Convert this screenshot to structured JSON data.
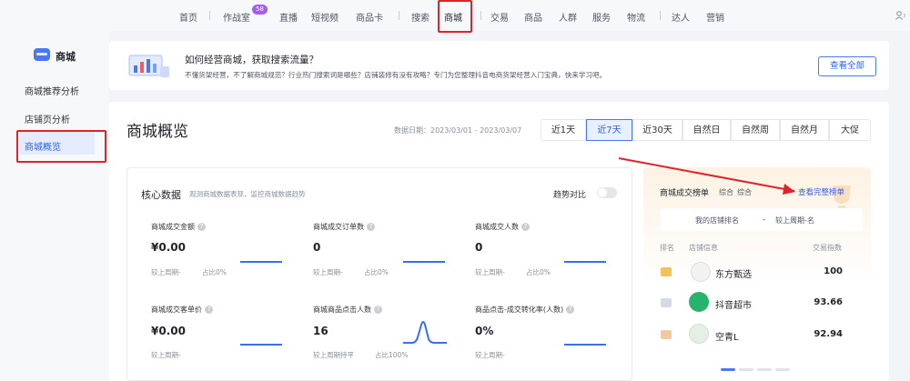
{
  "nav": {
    "items": [
      "首页",
      "作战室",
      "直播",
      "短视频",
      "商品卡",
      "搜索",
      "商城",
      "交易",
      "商品",
      "人群",
      "服务",
      "物流",
      "达人",
      "营销"
    ],
    "badge": "58",
    "active": "商城"
  },
  "sidebar": {
    "title": "商城",
    "items": [
      {
        "label": "商城推荐分析"
      },
      {
        "label": "店铺页分析"
      },
      {
        "label": "商城概览"
      }
    ]
  },
  "banner": {
    "title": "如何经营商城，获取搜索流量？",
    "desc": "不懂货架经营，不了解商城规范？行业热门搜索词是哪些？店铺装修有没有攻略？专门为您整理抖音电商货架经营入门宝典，快来学习吧。",
    "button": "查看全部"
  },
  "overview": {
    "title": "商城概览",
    "date_range": "数据日期：2023/03/01 - 2023/03/07",
    "tabs": [
      "近1天",
      "近7天",
      "近30天",
      "自然日",
      "自然周",
      "自然月",
      "大促"
    ],
    "active_tab": "近7天"
  },
  "core": {
    "title": "核心数据",
    "subtitle": "观测商城数据表现，监控商城数据趋势",
    "toggle_label": "趋势对比",
    "toggle_on": false,
    "metrics": [
      {
        "label": "商城成交金额",
        "value": "¥0.00",
        "compare": "较上周期-",
        "share": "占比0%"
      },
      {
        "label": "商城成交订单数",
        "value": "0",
        "compare": "较上周期-",
        "share": "占比0%"
      },
      {
        "label": "商城成交人数",
        "value": "0",
        "compare": "较上周期-",
        "share": "占比0%"
      },
      {
        "label": "商城成交客单价",
        "value": "¥0.00",
        "compare": "较上周期-",
        "share": ""
      },
      {
        "label": "商城商品点击人数",
        "value": "16",
        "compare": "较上周期持平",
        "share": "占比100%"
      },
      {
        "label": "商品点击-成交转化率(人数)",
        "value": "0%",
        "compare": "较上周期-",
        "share": ""
      }
    ]
  },
  "ranking": {
    "title": "商城成交榜单",
    "subtitle": "综合",
    "view_all": "查看完整榜单",
    "my_rank": "我的店铺排名",
    "my_rank_value": "-",
    "my_rank_compare": "较上周期-名",
    "col_rank": "排名",
    "col_store": "店铺信息",
    "col_index": "交易指数",
    "rows": [
      {
        "name": "东方甄选",
        "index": "100"
      },
      {
        "name": "抖音超市",
        "index": "93.66"
      },
      {
        "name": "空青L",
        "index": "92.94"
      }
    ]
  }
}
